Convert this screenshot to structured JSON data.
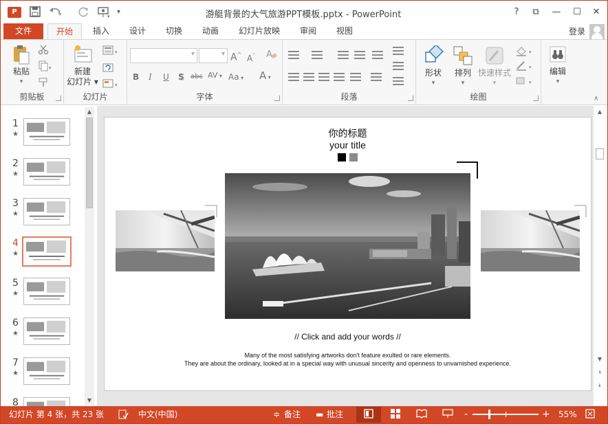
{
  "window": {
    "title": "游艇背景的大气旅游PPT模板.pptx - PowerPoint",
    "app_icon": "P",
    "controls": [
      "?",
      "⧉",
      "—",
      "☐",
      "✕"
    ]
  },
  "quick_access": {
    "icons": [
      "save-icon",
      "undo-icon",
      "redo-icon",
      "present-icon",
      "customize-icon"
    ]
  },
  "ribbon_tabs": [
    "文件",
    "开始",
    "插入",
    "设计",
    "切换",
    "动画",
    "幻灯片放映",
    "审阅",
    "视图"
  ],
  "active_tab": "开始",
  "account": {
    "login": "登录"
  },
  "ribbon": {
    "clipboard": {
      "label": "剪贴板",
      "paste": "粘贴"
    },
    "slides": {
      "label": "幻灯片",
      "new_slide_line1": "新建",
      "new_slide_line2": "幻灯片"
    },
    "font": {
      "label": "字体",
      "buttons": [
        "B",
        "I",
        "U",
        "S",
        "abc",
        "AV",
        "Aa",
        "A"
      ]
    },
    "paragraph": {
      "label": "段落"
    },
    "drawing": {
      "label": "绘图",
      "shapes": "形状",
      "arrange": "排列",
      "quick_styles": "快速样式"
    },
    "editing": {
      "label": "编辑"
    }
  },
  "thumbnails": [
    {
      "num": "1",
      "star": "★"
    },
    {
      "num": "2",
      "star": "★"
    },
    {
      "num": "3",
      "star": "★"
    },
    {
      "num": "4",
      "star": "★",
      "selected": true
    },
    {
      "num": "5",
      "star": "★"
    },
    {
      "num": "6",
      "star": "★"
    },
    {
      "num": "7",
      "star": "★"
    },
    {
      "num": "8",
      "star": ""
    }
  ],
  "slide": {
    "title_cn": "你的标题",
    "title_en": "your title",
    "caption": "// Click and add your words //",
    "body_line1": "Many of the most satisfying artworks don't feature exulted or rare elements.",
    "body_line2": "They are about the ordinary, looked at in a special way with unusual sincerity and openness to unvarnished experience."
  },
  "status_bar": {
    "slide_info": "幻灯片 第 4 张，共 23 张",
    "language": "中文(中国)",
    "notes": "备注",
    "comments": "批注",
    "zoom_minus": "-",
    "zoom_plus": "+",
    "zoom": "55%",
    "zoom_level": 0.55
  },
  "colors": {
    "accent": "#d24726",
    "ribbon_bg": "#f7f7f7",
    "editor_bg": "#e6e6e6"
  }
}
